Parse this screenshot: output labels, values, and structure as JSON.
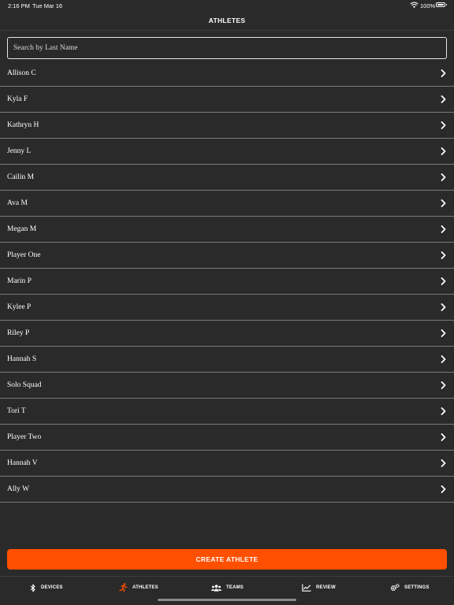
{
  "status_bar": {
    "time": "2:16 PM",
    "date": "Tue Mar 16",
    "battery": "100%"
  },
  "header": {
    "title": "ATHLETES"
  },
  "search": {
    "placeholder": "Search by Last Name",
    "value": ""
  },
  "athletes": [
    {
      "name": "Allison C"
    },
    {
      "name": "Kyla F"
    },
    {
      "name": "Kathryn H"
    },
    {
      "name": "Jenny L"
    },
    {
      "name": "Cailin M"
    },
    {
      "name": "Ava M"
    },
    {
      "name": "Megan M"
    },
    {
      "name": "Player One"
    },
    {
      "name": "Marin P"
    },
    {
      "name": "Kylee P"
    },
    {
      "name": "Riley P"
    },
    {
      "name": "Hannah S"
    },
    {
      "name": "Solo Squad"
    },
    {
      "name": "Tori T"
    },
    {
      "name": "Player Two"
    },
    {
      "name": "Hannah V"
    },
    {
      "name": "Ally W"
    }
  ],
  "actions": {
    "create_label": "CREATE ATHLETE"
  },
  "tabs": [
    {
      "label": "DEVICES",
      "icon": "bluetooth-icon",
      "active": false
    },
    {
      "label": "ATHLETES",
      "icon": "runner-icon",
      "active": true
    },
    {
      "label": "TEAMS",
      "icon": "group-icon",
      "active": false
    },
    {
      "label": "REVIEW",
      "icon": "chart-line-icon",
      "active": false
    },
    {
      "label": "SETTINGS",
      "icon": "gears-icon",
      "active": false
    }
  ],
  "colors": {
    "accent": "#ff4f00",
    "background": "#2a2a2a",
    "divider": "#7a7a7a"
  }
}
